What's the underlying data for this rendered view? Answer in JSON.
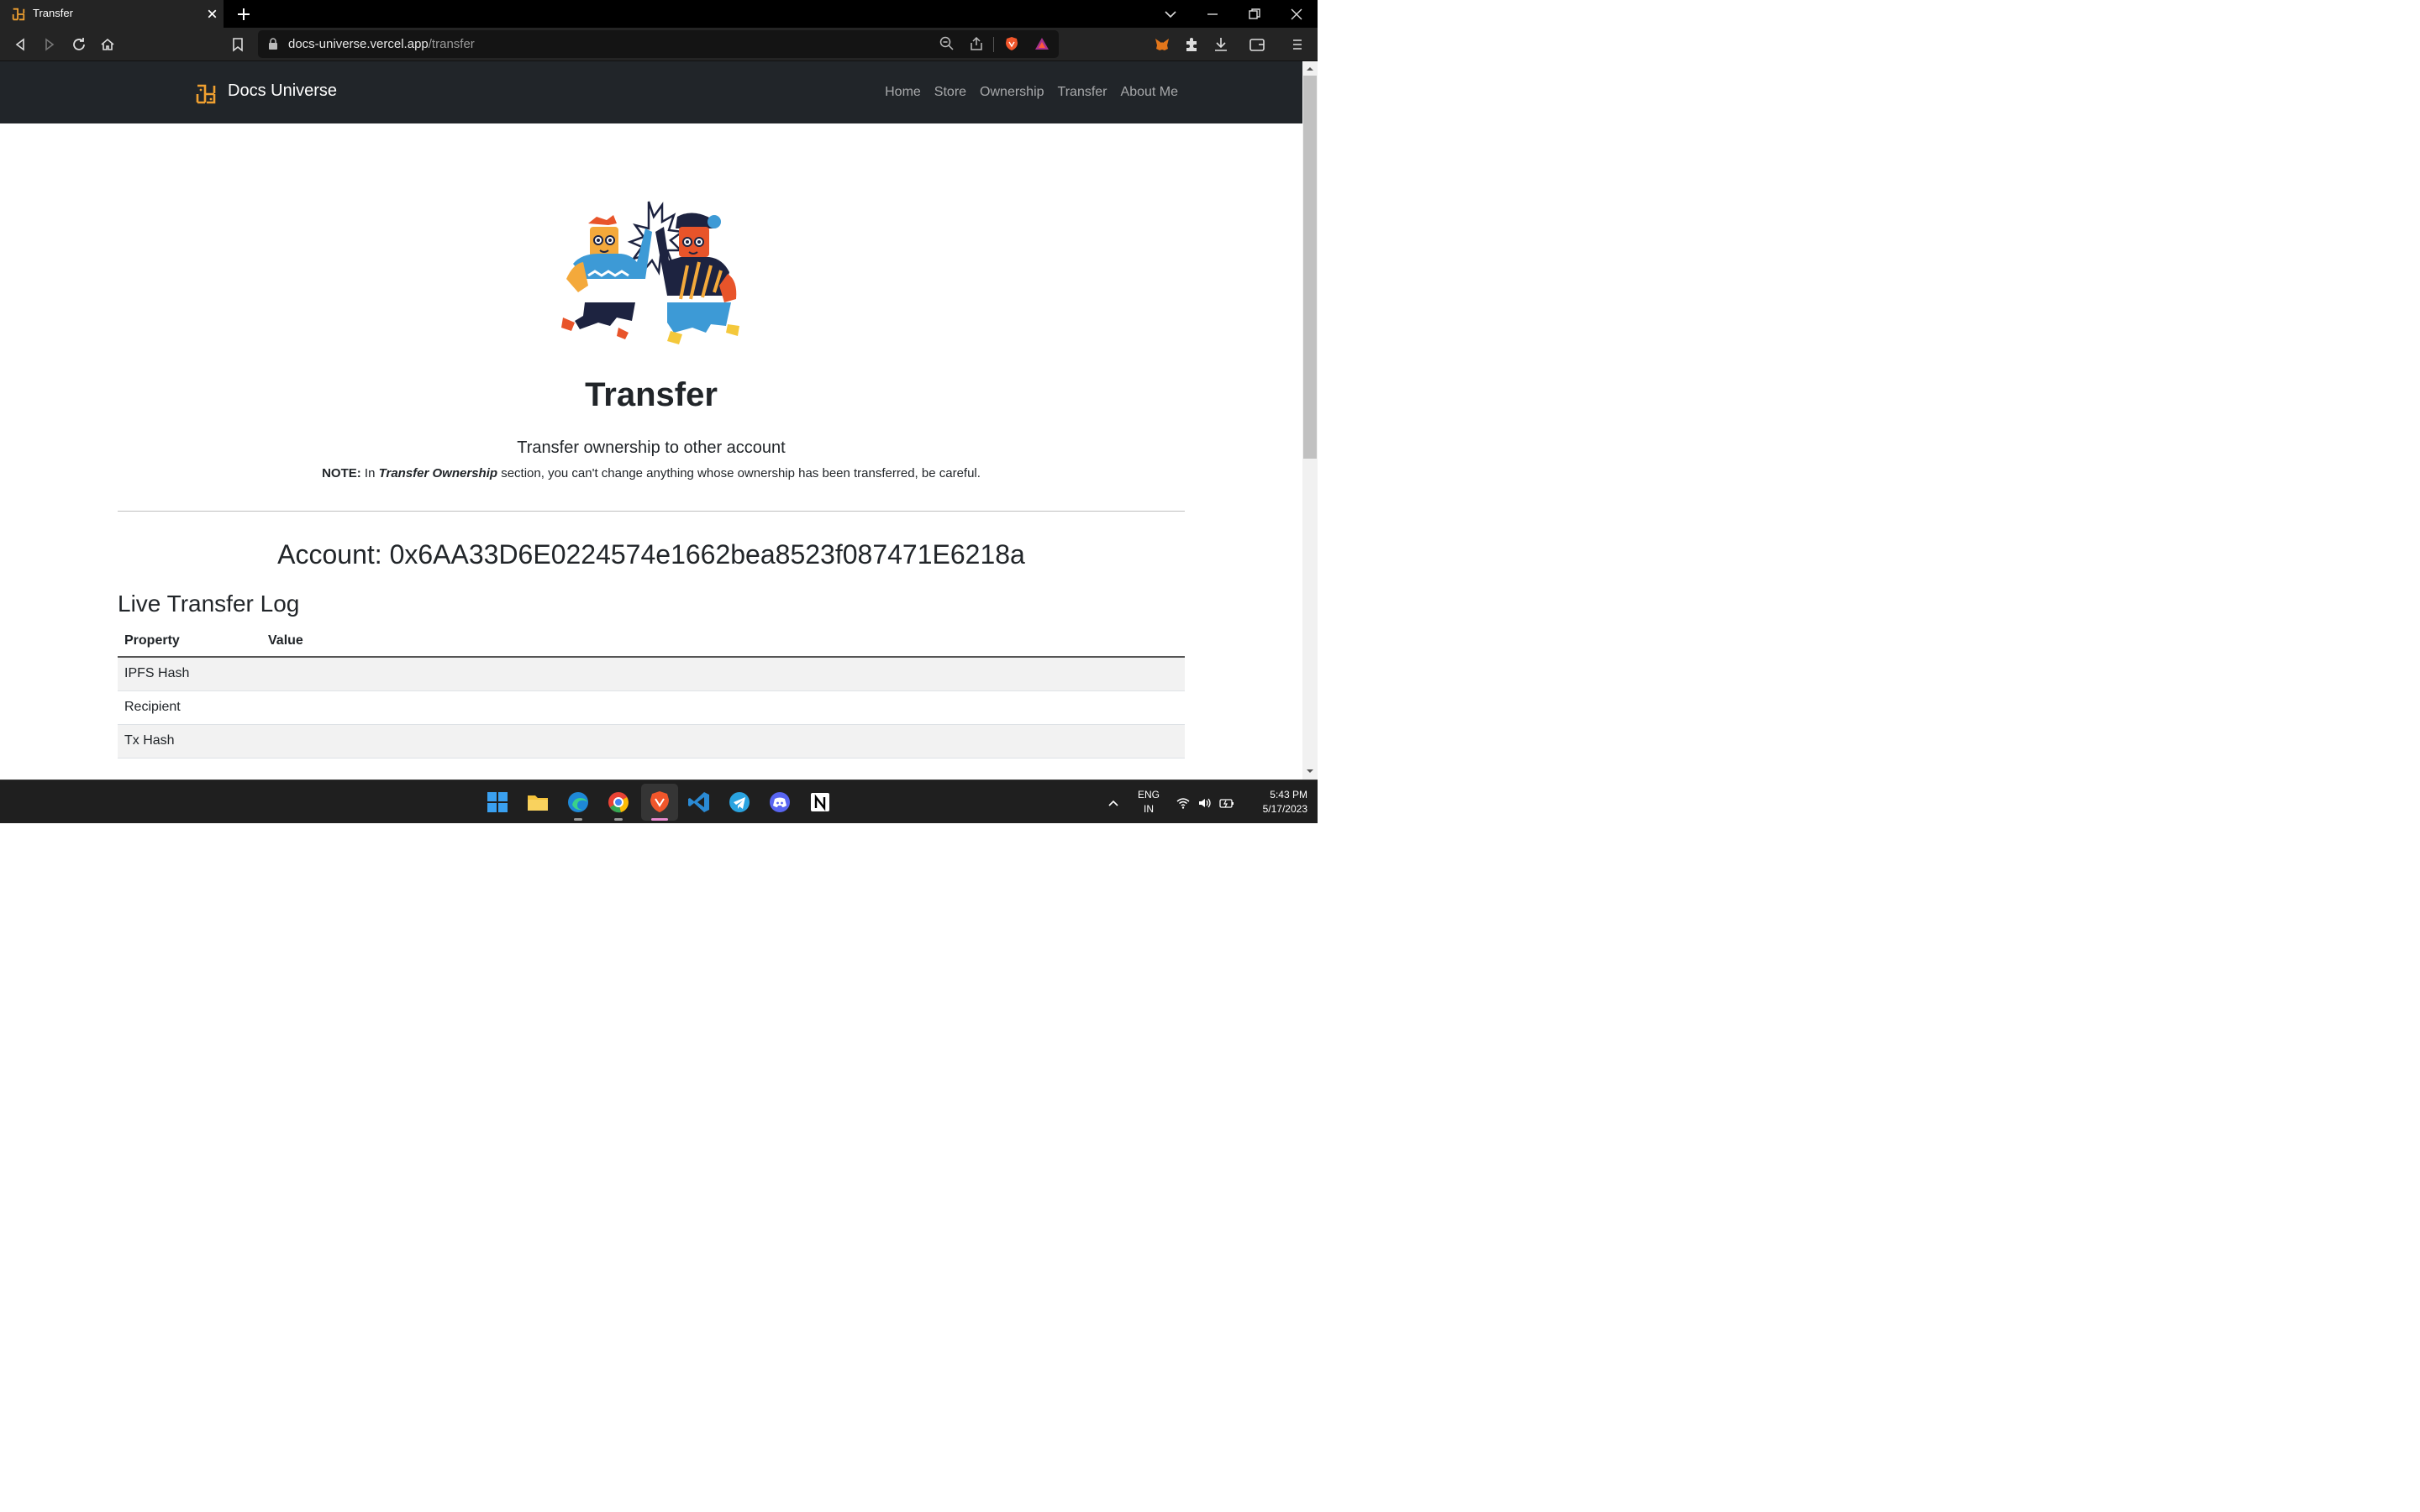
{
  "browser": {
    "tab_title": "Transfer",
    "url_host": "docs-universe.vercel.app",
    "url_path": "/transfer"
  },
  "navbar": {
    "brand": "Docs Universe",
    "links": [
      "Home",
      "Store",
      "Ownership",
      "Transfer",
      "About Me"
    ]
  },
  "page": {
    "title": "Transfer",
    "subtitle": "Transfer ownership to other account",
    "note_label": "NOTE:",
    "note_pre": "In",
    "note_emph": "Transfer Ownership",
    "note_post": "section, you can't change anything whose ownership has been transferred, be careful.",
    "account_label": "Account:",
    "account_address": "0x6AA33D6E0224574e1662bea8523f087471E6218a",
    "log_title": "Live Transfer Log",
    "table": {
      "headers": [
        "Property",
        "Value"
      ],
      "rows": [
        {
          "property": "IPFS Hash",
          "value": ""
        },
        {
          "property": "Recipient",
          "value": ""
        },
        {
          "property": "Tx Hash",
          "value": ""
        }
      ]
    }
  },
  "taskbar": {
    "language_line1": "ENG",
    "language_line2": "IN",
    "time": "5:43 PM",
    "date": "5/17/2023",
    "apps": [
      "windows-start",
      "file-explorer",
      "edge",
      "chrome",
      "brave",
      "vscode",
      "telegram",
      "discord",
      "notion"
    ]
  },
  "colors": {
    "navbar_bg": "#212529",
    "brand_accent": "#f0a030",
    "table_stripe": "#f2f2f2"
  }
}
